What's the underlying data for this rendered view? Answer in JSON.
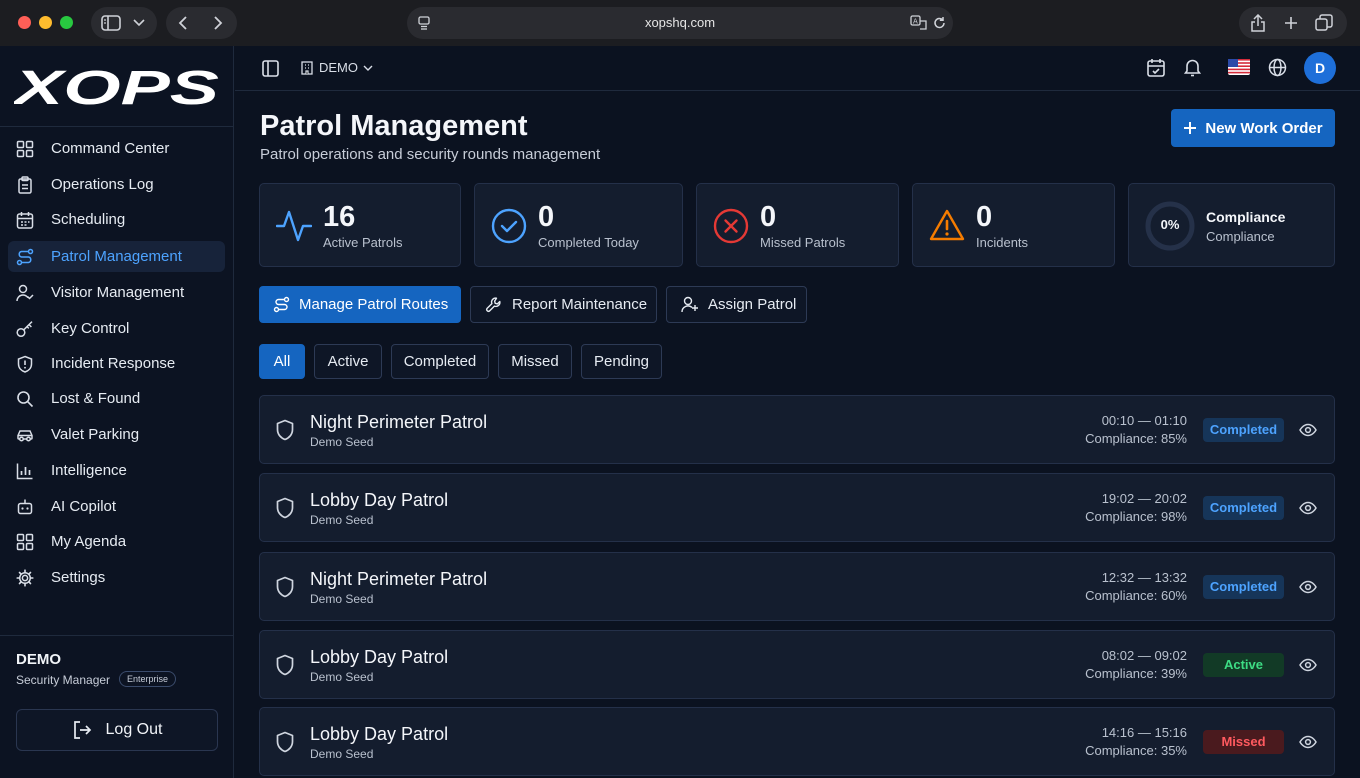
{
  "browser": {
    "url": "xopshq.com"
  },
  "sidebar": {
    "logo_text": "XOPS",
    "items": [
      {
        "label": "Command Center",
        "icon": "grid-icon"
      },
      {
        "label": "Operations Log",
        "icon": "clipboard-icon"
      },
      {
        "label": "Scheduling",
        "icon": "calendar-icon"
      },
      {
        "label": "Patrol Management",
        "icon": "route-icon",
        "active": true
      },
      {
        "label": "Visitor Management",
        "icon": "user-check-icon"
      },
      {
        "label": "Key Control",
        "icon": "key-icon"
      },
      {
        "label": "Incident Response",
        "icon": "shield-alert-icon"
      },
      {
        "label": "Lost & Found",
        "icon": "search-icon"
      },
      {
        "label": "Valet Parking",
        "icon": "car-icon"
      },
      {
        "label": "Intelligence",
        "icon": "chart-icon"
      },
      {
        "label": "AI Copilot",
        "icon": "bot-icon"
      },
      {
        "label": "My Agenda",
        "icon": "grid-icon"
      },
      {
        "label": "Settings",
        "icon": "gear-icon"
      }
    ],
    "user": {
      "name": "DEMO",
      "role": "Security Manager",
      "plan": "Enterprise"
    },
    "logout_label": "Log Out"
  },
  "topbar": {
    "org_label": "DEMO",
    "avatar_initial": "D"
  },
  "header": {
    "title": "Patrol Management",
    "subtitle": "Patrol operations and security rounds management",
    "new_work_order_label": "New Work Order"
  },
  "stats": [
    {
      "value": "16",
      "label": "Active Patrols",
      "icon": "activity-icon",
      "color": "#4da3ff"
    },
    {
      "value": "0",
      "label": "Completed Today",
      "icon": "check-circle-icon",
      "color": "#4da3ff"
    },
    {
      "value": "0",
      "label": "Missed Patrols",
      "icon": "x-circle-icon",
      "color": "#e53935"
    },
    {
      "value": "0",
      "label": "Incidents",
      "icon": "warning-icon",
      "color": "#f57c00"
    },
    {
      "value": "0%",
      "label": "Compliance",
      "sublabel": "Compliance",
      "icon": "progress-ring",
      "progress": 0
    }
  ],
  "actions": {
    "manage_routes_label": "Manage Patrol Routes",
    "report_maintenance_label": "Report Maintenance",
    "assign_patrol_label": "Assign Patrol"
  },
  "filters": [
    {
      "label": "All",
      "active": true
    },
    {
      "label": "Active"
    },
    {
      "label": "Completed"
    },
    {
      "label": "Missed"
    },
    {
      "label": "Pending"
    }
  ],
  "patrols": [
    {
      "name": "Night Perimeter Patrol",
      "source": "Demo Seed",
      "time": "00:10 — 01:10",
      "compliance": "Compliance: 85%",
      "status": "Completed"
    },
    {
      "name": "Lobby Day Patrol",
      "source": "Demo Seed",
      "time": "19:02 — 20:02",
      "compliance": "Compliance: 98%",
      "status": "Completed"
    },
    {
      "name": "Night Perimeter Patrol",
      "source": "Demo Seed",
      "time": "12:32 — 13:32",
      "compliance": "Compliance: 60%",
      "status": "Completed"
    },
    {
      "name": "Lobby Day Patrol",
      "source": "Demo Seed",
      "time": "08:02 — 09:02",
      "compliance": "Compliance: 39%",
      "status": "Active"
    },
    {
      "name": "Lobby Day Patrol",
      "source": "Demo Seed",
      "time": "14:16 — 15:16",
      "compliance": "Compliance: 35%",
      "status": "Missed"
    }
  ],
  "colors": {
    "accent": "#1565c0",
    "accent_text": "#4da3ff",
    "completed": "#4da3ff",
    "active": "#3ddc84",
    "missed": "#ff5a5f"
  }
}
